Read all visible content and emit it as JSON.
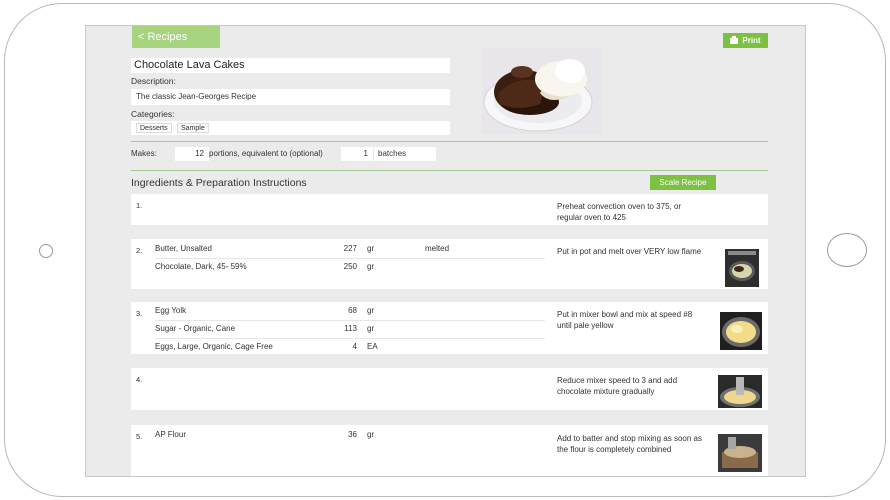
{
  "nav": {
    "back_label": "< Recipes",
    "print_label": "Print"
  },
  "recipe": {
    "title": "Chocolate Lava Cakes",
    "description_label": "Description:",
    "description": "The classic Jean-Georges Recipe",
    "categories_label": "Categories:",
    "categories": [
      "Desserts",
      "Sample"
    ]
  },
  "makes": {
    "label": "Makes:",
    "portions": "12",
    "portions_text": "portions, equivalent to (optional)",
    "batches": "1",
    "unit": "batches"
  },
  "instructions": {
    "section_title": "Ingredients & Preparation Instructions",
    "scale_label": "Scale Recipe",
    "steps": [
      {
        "num": "1.",
        "ingredients": [],
        "text": "Preheat convection oven to 375, or regular oven to 425"
      },
      {
        "num": "2.",
        "ingredients": [
          {
            "name": "Butter, Unsalted",
            "qty": "227",
            "unit": "gr",
            "note": "melted"
          },
          {
            "name": "Chocolate, Dark, 45- 59%",
            "qty": "250",
            "unit": "gr",
            "note": ""
          }
        ],
        "text": "Put in pot and melt over VERY low flame"
      },
      {
        "num": "3.",
        "ingredients": [
          {
            "name": "Egg Yolk",
            "qty": "68",
            "unit": "gr",
            "note": ""
          },
          {
            "name": "Sugar - Organic, Cane",
            "qty": "113",
            "unit": "gr",
            "note": ""
          },
          {
            "name": "Eggs, Large, Organic, Cage Free",
            "qty": "4",
            "unit": "EA",
            "note": ""
          }
        ],
        "text": "Put in mixer bowl and mix at speed #8 until pale yellow"
      },
      {
        "num": "4.",
        "ingredients": [],
        "text": "Reduce mixer speed to 3 and add chocolate mixture gradually"
      },
      {
        "num": "5.",
        "ingredients": [
          {
            "name": "AP Flour",
            "qty": "36",
            "unit": "gr",
            "note": ""
          }
        ],
        "text": "Add to batter and stop mixing as soon as the flour is completely combined"
      }
    ]
  },
  "colors": {
    "accent": "#7cc142",
    "back_button": "#a6d37d",
    "screen_bg": "#ebebec",
    "divider": "#a9c996"
  }
}
